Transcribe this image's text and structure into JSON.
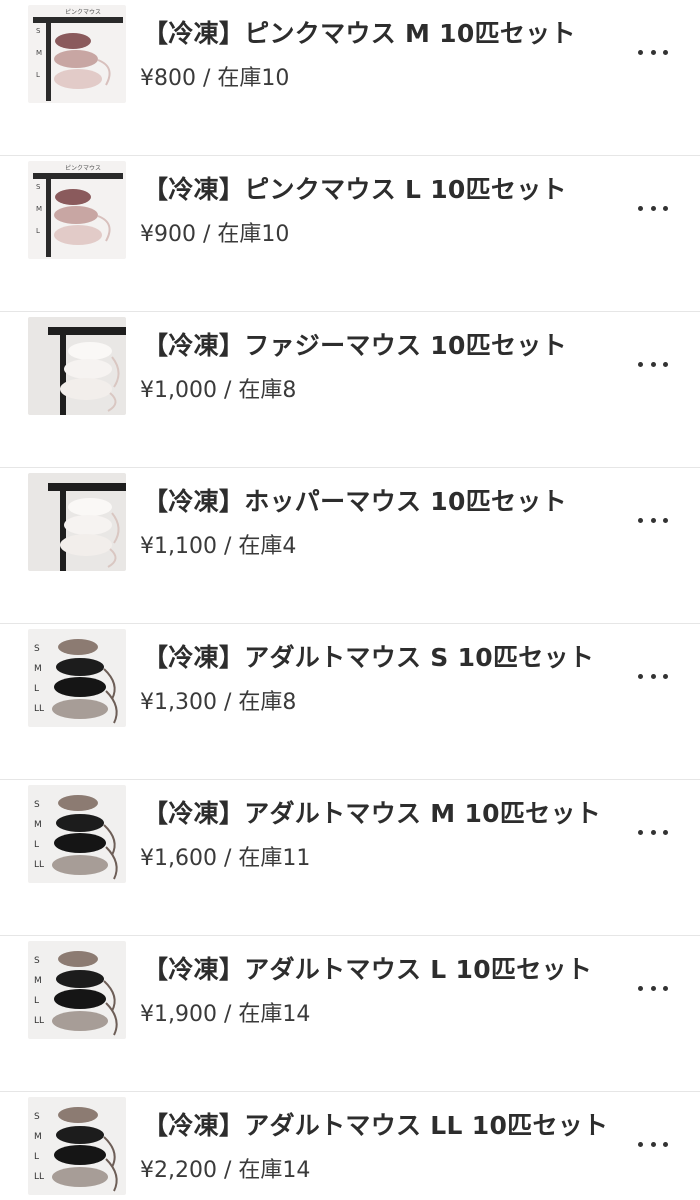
{
  "products": [
    {
      "title": "【冷凍】ピンクマウス M 10匹セット",
      "price": "¥800 / 在庫10",
      "thumb": "pink",
      "thumb_label": "ピンクマウス"
    },
    {
      "title": "【冷凍】ピンクマウス L 10匹セット",
      "price": "¥900 / 在庫10",
      "thumb": "pink",
      "thumb_label": "ピンクマウス"
    },
    {
      "title": "【冷凍】ファジーマウス 10匹セット",
      "price": "¥1,000 / 在庫8",
      "thumb": "fuzzy",
      "thumb_label": ""
    },
    {
      "title": "【冷凍】ホッパーマウス 10匹セット",
      "price": "¥1,100 / 在庫4",
      "thumb": "fuzzy",
      "thumb_label": ""
    },
    {
      "title": "【冷凍】アダルトマウス S 10匹セット",
      "price": "¥1,300 / 在庫8",
      "thumb": "adult",
      "thumb_label": ""
    },
    {
      "title": "【冷凍】アダルトマウス M 10匹セット",
      "price": "¥1,600 / 在庫11",
      "thumb": "adult",
      "thumb_label": ""
    },
    {
      "title": "【冷凍】アダルトマウス L 10匹セット",
      "price": "¥1,900 / 在庫14",
      "thumb": "adult",
      "thumb_label": ""
    },
    {
      "title": "【冷凍】アダルトマウス LL 10匹セット",
      "price": "¥2,200 / 在庫14",
      "thumb": "adult",
      "thumb_label": ""
    }
  ],
  "size_letters": {
    "pink": [
      "S",
      "M",
      "L"
    ],
    "adult": [
      "S",
      "M",
      "L",
      "LL"
    ]
  },
  "icons": {
    "more": "more-horizontal-icon"
  }
}
